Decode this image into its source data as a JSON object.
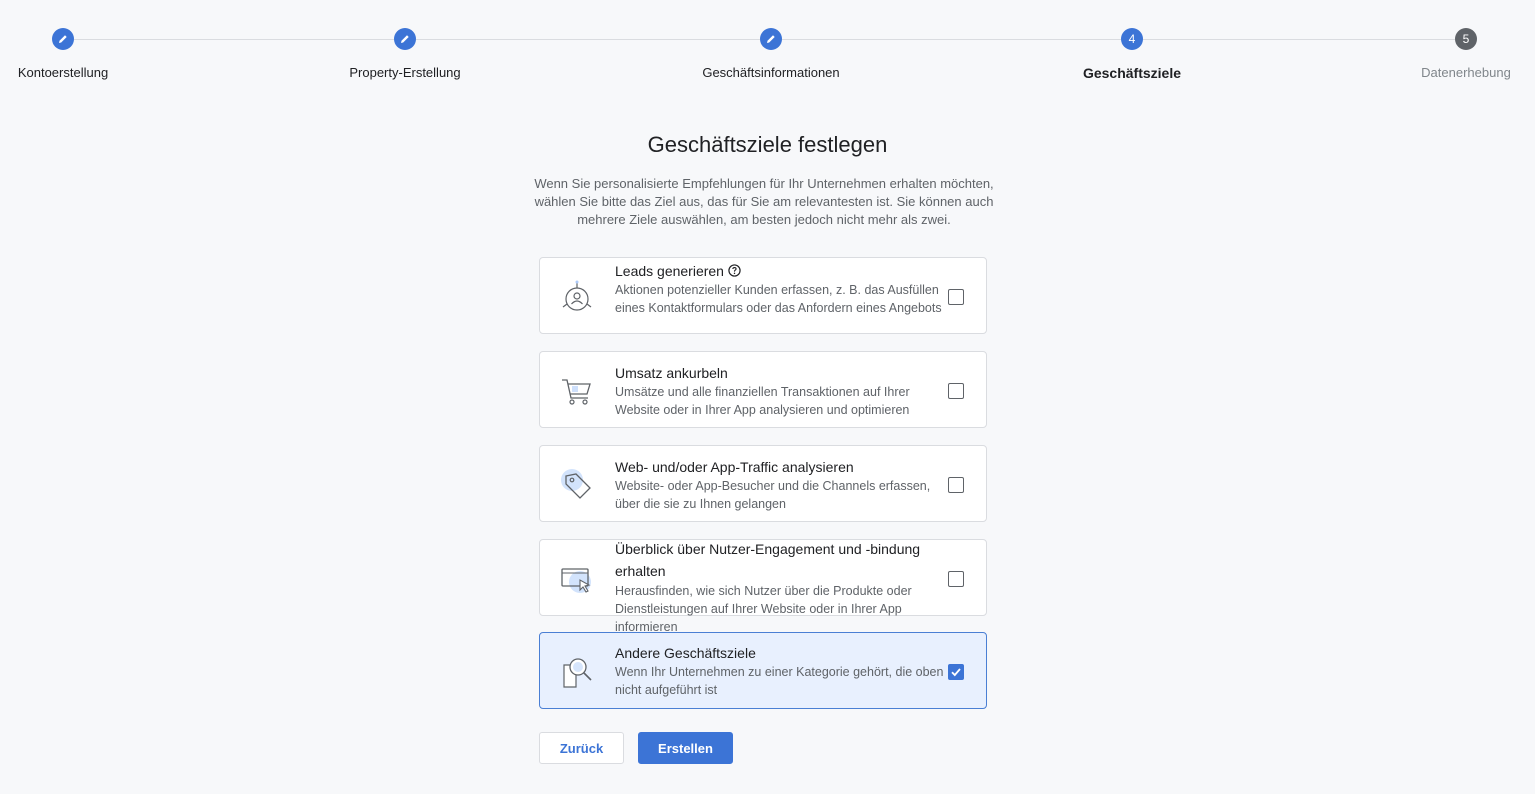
{
  "stepper": {
    "steps": [
      {
        "label": "Kontoerstellung",
        "state": "done"
      },
      {
        "label": "Property-Erstellung",
        "state": "done"
      },
      {
        "label": "Geschäftsinformationen",
        "state": "done"
      },
      {
        "label": "Geschäftsziele",
        "state": "active",
        "number": "4"
      },
      {
        "label": "Datenerhebung",
        "state": "pending",
        "number": "5"
      }
    ]
  },
  "main": {
    "title": "Geschäftsziele festlegen",
    "description": "Wenn Sie personalisierte Empfehlungen für Ihr Unternehmen erhalten möchten, wählen Sie bitte das Ziel aus, das für Sie am relevantesten ist. Sie können auch mehrere Ziele auswählen, am besten jedoch nicht mehr als zwei."
  },
  "goals": [
    {
      "title": "Leads generieren",
      "description": "Aktionen potenzieller Kunden erfassen, z. B. das Ausfüllen eines Kontaktformulars oder das Anfordern eines Angebots",
      "checked": false,
      "icon": "leads-icon"
    },
    {
      "title": "Umsatz ankurbeln",
      "description": "Umsätze und alle finanziellen Transaktionen auf Ihrer Website oder in Ihrer App analysieren und optimieren",
      "checked": false,
      "icon": "shopping-cart-icon"
    },
    {
      "title": "Web- und/oder App-Traffic analysieren",
      "description": "Website- oder App-Besucher und die Channels erfassen, über die sie zu Ihnen gelangen",
      "checked": false,
      "icon": "tag-icon"
    },
    {
      "title": "Überblick über Nutzer-Engagement und -bindung erhalten",
      "description": "Herausfinden, wie sich Nutzer über die Produkte oder Dienstleistungen auf Ihrer Website oder in Ihrer App informieren",
      "checked": false,
      "icon": "screen-cursor-icon"
    },
    {
      "title": "Andere Geschäftsziele",
      "description": "Wenn Ihr Unternehmen zu einer Kategorie gehört, die oben nicht aufgeführt ist",
      "checked": true,
      "icon": "magnifier-document-icon"
    }
  ],
  "buttons": {
    "back_label": "Zurück",
    "create_label": "Erstellen"
  },
  "colors": {
    "accent": "#3c74d6",
    "selected_bg": "#e8f0fe"
  }
}
